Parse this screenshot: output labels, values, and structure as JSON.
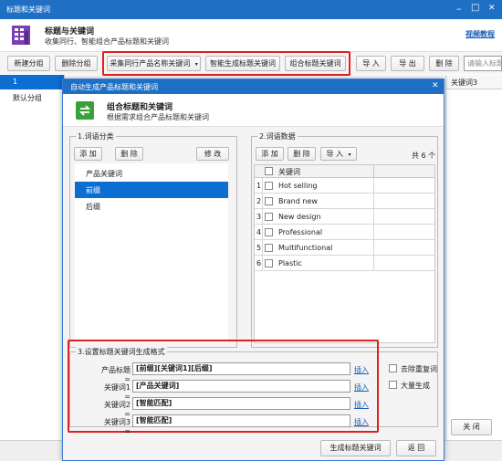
{
  "window": {
    "title": "标题和关键词",
    "controls": [
      "–",
      "□",
      "✕"
    ]
  },
  "header": {
    "title": "标题与关键词",
    "subtitle": "收集同行、智能组合产品标题和关键词",
    "video_link": "视频教程"
  },
  "toolbar": {
    "new_group": "新建分组",
    "delete_group": "删除分组",
    "collect": "采集同行产品名称关键词",
    "smart_generate": "智能生成标题关键词",
    "combine": "组合标题关键词",
    "import": "导 入",
    "export": "导 出",
    "delete": "删 除",
    "search_placeholder": "请输入标题"
  },
  "main": {
    "groups": [
      "1",
      "默认分组"
    ],
    "column_header": "关键词3",
    "close_button": "关 闭"
  },
  "dialog": {
    "title": "自动生成产品标题和关键词",
    "header_title": "组合标题和关键词",
    "header_subtitle": "根据需求组合产品标题和关键词",
    "section1": {
      "label": "1.词语分类",
      "add": "添 加",
      "delete": "删 除",
      "edit": "修 改",
      "items": [
        "产品关键词",
        "前缀",
        "后缀"
      ],
      "selected_index": 1
    },
    "section2": {
      "label": "2.词语数据",
      "add": "添 加",
      "delete": "删 除",
      "import": "导 入",
      "count": "共 6 个",
      "column": "关键词",
      "rows": [
        {
          "num": "1",
          "text": "Hot selling"
        },
        {
          "num": "2",
          "text": "Brand new"
        },
        {
          "num": "3",
          "text": "New design"
        },
        {
          "num": "4",
          "text": "Professional"
        },
        {
          "num": "5",
          "text": "Multifunctional"
        },
        {
          "num": "6",
          "text": "Plastic"
        }
      ]
    },
    "section3": {
      "label": "3.设置标题关键词生成格式",
      "fields": [
        {
          "label": "产品标题 =",
          "value": "[前缀][关键词1][后缀]",
          "insert": "插入"
        },
        {
          "label": "关键词1 =",
          "value": "[产品关键词]",
          "insert": "插入"
        },
        {
          "label": "关键词2 =",
          "value": "[智能匹配]",
          "insert": "插入"
        },
        {
          "label": "关键词3 =",
          "value": "[智能匹配]",
          "insert": "插入"
        }
      ],
      "dedupe": "去除重复词",
      "bulk": "大量生成"
    },
    "generate_button": "生成标题关键词",
    "back_button": "返 回"
  },
  "colors": {
    "title_bar": "#1f6fc5",
    "selection": "#0b6ed0",
    "highlight_box": "#e02020",
    "link": "#1b5fb8"
  }
}
